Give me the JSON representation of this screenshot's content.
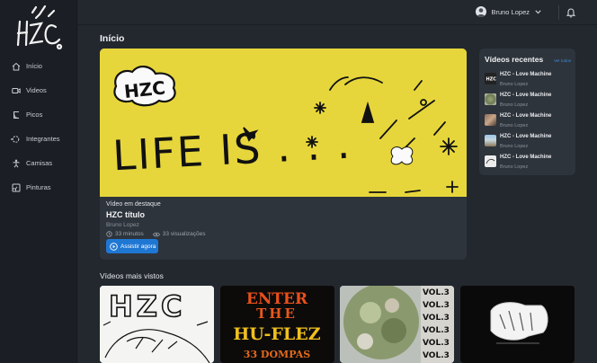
{
  "brand": {
    "logo_text": "HZC"
  },
  "sidebar": {
    "items": [
      {
        "label": "Início",
        "icon": "home-icon"
      },
      {
        "label": "Videos",
        "icon": "video-icon"
      },
      {
        "label": "Picos",
        "icon": "ramp-icon"
      },
      {
        "label": "Integrantes",
        "icon": "members-icon"
      },
      {
        "label": "Camisas",
        "icon": "shirt-icon"
      },
      {
        "label": "Pinturas",
        "icon": "painting-icon"
      }
    ]
  },
  "header": {
    "user_name": "Bruno Lopez"
  },
  "page": {
    "title": "Início"
  },
  "featured": {
    "eyebrow": "Vídeo em destaque",
    "title": "HZC título",
    "author": "Bruno Lopez",
    "duration": "33 minutos",
    "views": "33 visualizações",
    "button_label": "Assistir agora",
    "hero_text": "LIFE IS . . ."
  },
  "recent": {
    "title": "Vídeos recentes",
    "see_all": "Ver todos",
    "items": [
      {
        "title": "HZC - Love Machine",
        "author": "Bruno Lopez"
      },
      {
        "title": "HZC - Love Machine",
        "author": "Bruno Lopez"
      },
      {
        "title": "HZC - Love Machine",
        "author": "Bruno Lopez"
      },
      {
        "title": "HZC - Love Machine",
        "author": "Bruno Lopez"
      },
      {
        "title": "HZC - Love Machine",
        "author": "Bruno Lopez"
      }
    ]
  },
  "most_viewed": {
    "title": "Vídeos mais vistos",
    "cards": [
      {
        "art_text": "HZC"
      },
      {
        "art_text_1": "ENTER",
        "art_text_2": "THE",
        "art_text_3": "HU-FLEZ",
        "art_text_4": "33 DOMPAS"
      },
      {
        "art_text": "VOL.3"
      },
      {
        "art_text": ""
      }
    ]
  },
  "colors": {
    "accent": "#1f77d4",
    "hero": "#e6d63b",
    "background": "#23282f",
    "panel": "#2e343c"
  }
}
